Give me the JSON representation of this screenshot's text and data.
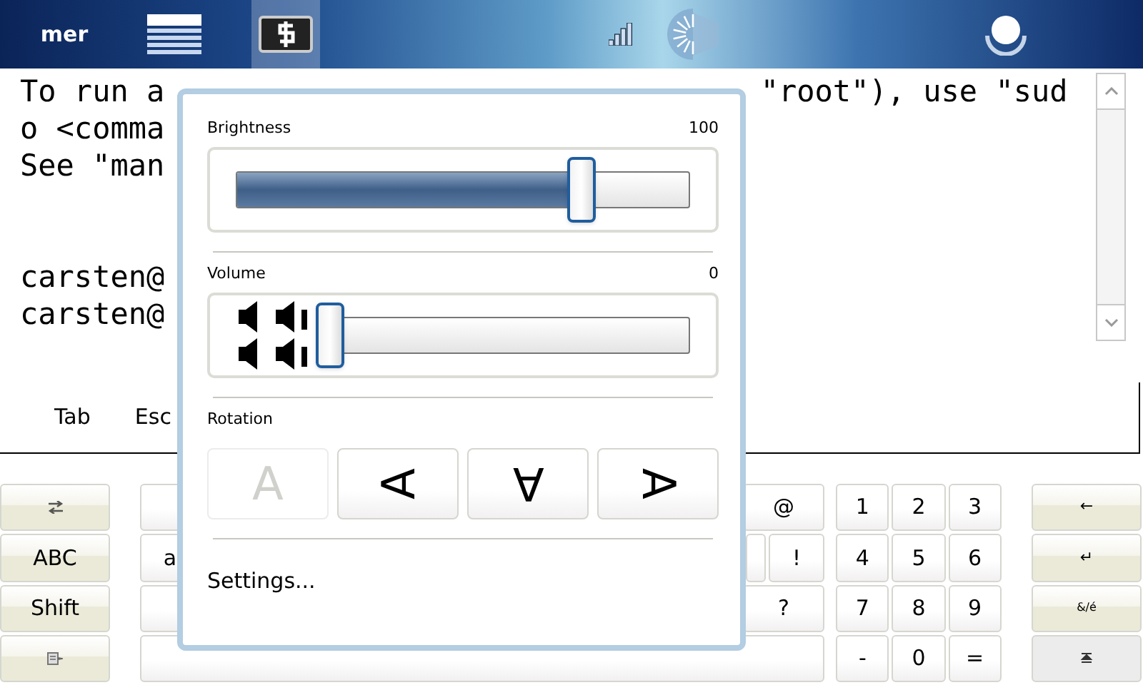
{
  "top_bar": {
    "logo": "mer",
    "launchers": [
      {
        "selected": false
      },
      {
        "selected": true
      }
    ]
  },
  "terminal": {
    "lines": [
      {
        "kind": "text",
        "left": "To run a",
        "right": "\"root\"), use \"sud"
      },
      {
        "kind": "text",
        "left": "o <comma"
      },
      {
        "kind": "text",
        "left": "See \"man"
      },
      {
        "kind": "blank"
      },
      {
        "kind": "blank"
      },
      {
        "kind": "text",
        "left": "carsten@"
      },
      {
        "kind": "text",
        "left": "carsten@"
      }
    ]
  },
  "shortcut_keys": [
    "Tab",
    "Esc"
  ],
  "keyboard": {
    "left_keys": [
      {
        "kind": "icon"
      },
      {
        "kind": "text",
        "label": "ABC"
      },
      {
        "kind": "text",
        "label": "Shift"
      },
      {
        "kind": "icon"
      }
    ],
    "middle_keys": [
      "@",
      "a",
      "!",
      "?"
    ],
    "numpad": [
      "1",
      "2",
      "3",
      "4",
      "5",
      "6",
      "7",
      "8",
      "9",
      "-",
      "0",
      "="
    ],
    "right_keys": [
      {
        "kind": "text",
        "label": "←",
        "pressed": false
      },
      {
        "kind": "text",
        "label": "↵",
        "pressed": false
      },
      {
        "kind": "text",
        "label": "&/é",
        "pressed": false
      },
      {
        "kind": "icon",
        "pressed": true
      }
    ]
  },
  "popup": {
    "sliders": [
      {
        "kind": "brightness",
        "label": "Brightness",
        "reading": "100",
        "level": 0.78
      },
      {
        "kind": "volume",
        "label": "Volume",
        "reading": "0",
        "level": 0
      }
    ],
    "rotation": {
      "label": "Rotation",
      "options": [
        {
          "glyph": "A",
          "kind": "upright",
          "selected": true
        },
        {
          "glyph": "A",
          "kind": "left",
          "selected": false
        },
        {
          "glyph": "A",
          "kind": "inverted",
          "selected": false
        },
        {
          "glyph": "A",
          "kind": "right",
          "selected": false
        }
      ]
    },
    "settings": "Settings..."
  }
}
